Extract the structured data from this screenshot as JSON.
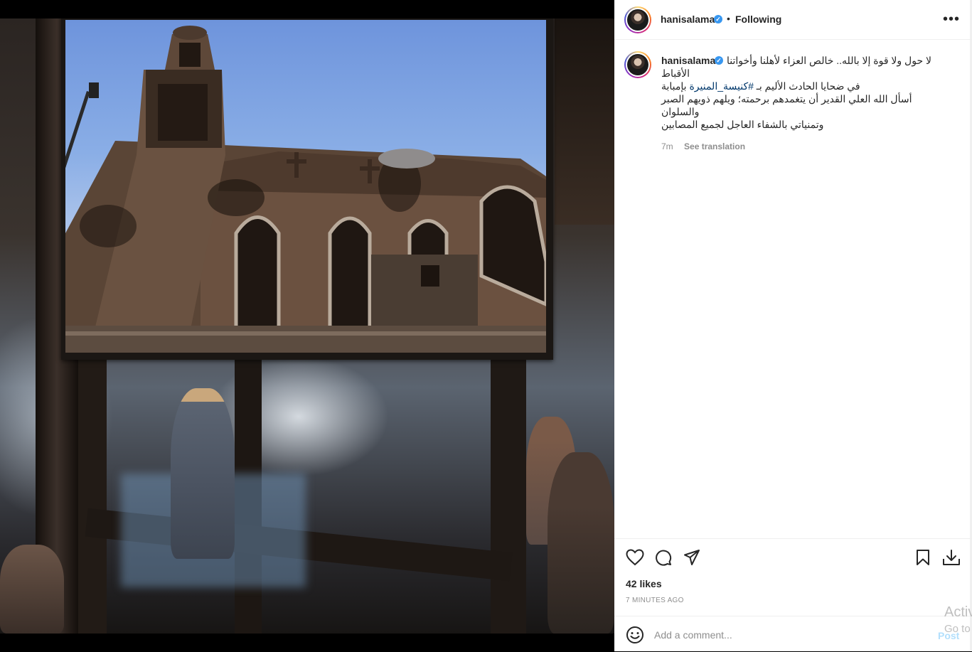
{
  "post": {
    "username": "hanisalama",
    "verified_mark": "✓",
    "separator": "•",
    "follow_status": "Following",
    "more_glyph": "•••",
    "caption_lines": [
      "لا حول ولا قوة إلا بالله.. خالص العزاء لأهلنا وأخواتنا",
      "الأقباط",
      "في ضحايا الحادث الأليم بـ #كنيسة_المنيرة بإمبابة",
      "أسأل الله العلي القدير أن يتغمدهم برحمته؛ ويلهم ذويهم الصبر",
      "والسلوان",
      "وتمنياتي بالشفاء العاجل لجميع المصابين"
    ],
    "caption_line3": {
      "before": "في ضحايا الحادث الأليم بـ ",
      "hashtag": "#كنيسة_المنيرة",
      "after": " بإمبابة"
    },
    "age": "7m",
    "see_translation": "See translation",
    "likes": "42 likes",
    "timestamp": "7 MINUTES AGO"
  },
  "comment": {
    "placeholder": "Add a comment...",
    "post_label": "Post"
  },
  "watermark": {
    "line1": "Activ",
    "line2": "Go to"
  },
  "icons": [
    "heart-icon",
    "comment-icon",
    "share-icon",
    "bookmark-icon",
    "download-icon",
    "emoji-icon"
  ],
  "colors": {
    "link": "#00376b",
    "verified": "#3897f0",
    "post_disabled": "#b2dffc",
    "muted": "#8e8e8e"
  }
}
